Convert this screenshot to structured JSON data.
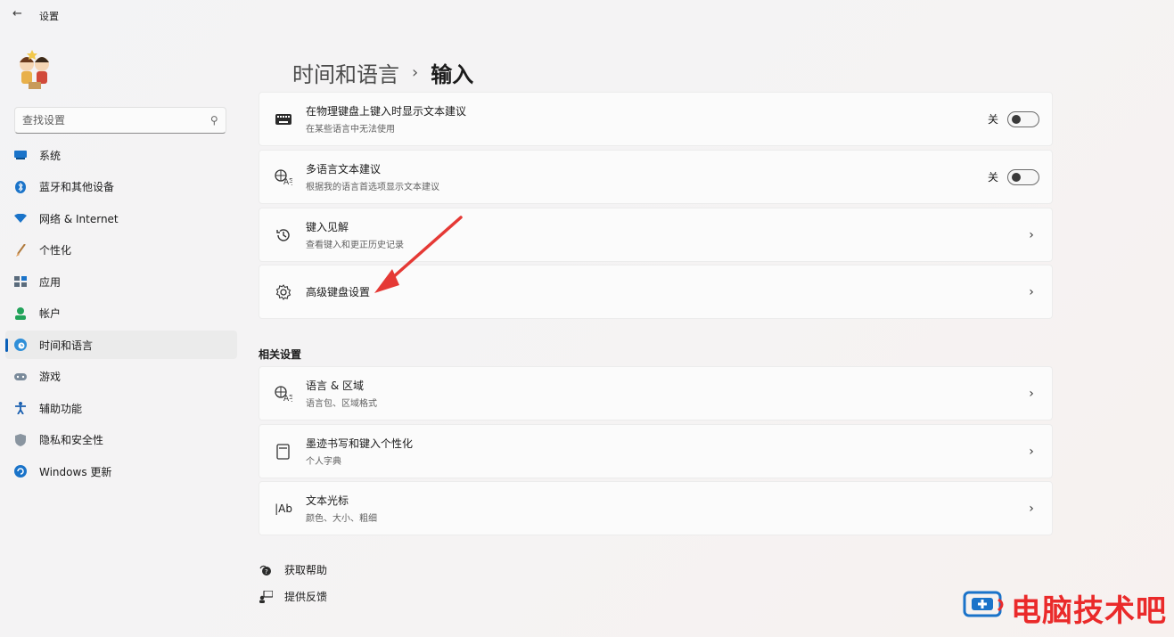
{
  "titlebar": {
    "back": "←",
    "title": "设置"
  },
  "search": {
    "placeholder": "查找设置"
  },
  "nav": {
    "items": [
      {
        "label": "系统",
        "icon": "monitor-icon"
      },
      {
        "label": "蓝牙和其他设备",
        "icon": "bluetooth-icon"
      },
      {
        "label": "网络 & Internet",
        "icon": "wifi-icon"
      },
      {
        "label": "个性化",
        "icon": "brush-icon"
      },
      {
        "label": "应用",
        "icon": "apps-icon"
      },
      {
        "label": "帐户",
        "icon": "person-icon"
      },
      {
        "label": "时间和语言",
        "icon": "globe-clock-icon",
        "active": true
      },
      {
        "label": "游戏",
        "icon": "gamepad-icon"
      },
      {
        "label": "辅助功能",
        "icon": "accessibility-icon"
      },
      {
        "label": "隐私和安全性",
        "icon": "shield-icon"
      },
      {
        "label": "Windows 更新",
        "icon": "update-icon"
      }
    ]
  },
  "heading": {
    "crumb": "时间和语言",
    "sep": "›",
    "current": "输入"
  },
  "cards": [
    {
      "title": "在物理键盘上键入时显示文本建议",
      "sub": "在某些语言中无法使用",
      "toggle_label": "关",
      "icon": "keyboard-icon"
    },
    {
      "title": "多语言文本建议",
      "sub": "根据我的语言首选项显示文本建议",
      "toggle_label": "关",
      "icon": "language-icon"
    },
    {
      "title": "键入见解",
      "sub": "查看键入和更正历史记录",
      "icon": "history-icon"
    },
    {
      "title": "高级键盘设置",
      "icon": "gear-icon"
    }
  ],
  "related": {
    "title": "相关设置",
    "cards": [
      {
        "title": "语言 & 区域",
        "sub": "语言包、区域格式",
        "icon": "language-icon"
      },
      {
        "title": "墨迹书写和键入个性化",
        "sub": "个人字典",
        "icon": "notebook-icon"
      },
      {
        "title": "文本光标",
        "sub": "颜色、大小、粗细",
        "icon": "text-cursor-icon",
        "icon_text": "|Ab"
      }
    ]
  },
  "footer": {
    "help": "获取帮助",
    "feedback": "提供反馈"
  },
  "watermark": {
    "text": "电脑技术吧"
  },
  "colors": {
    "accent": "#0a5fb8",
    "annotation_arrow": "#e53935",
    "watermark": "#ea2a2a"
  }
}
